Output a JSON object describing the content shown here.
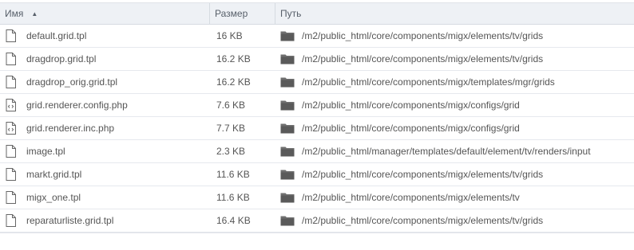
{
  "columns": {
    "name": "Имя",
    "size": "Размер",
    "path": "Путь"
  },
  "sort": {
    "column": "name",
    "direction": "ascending"
  },
  "files": [
    {
      "name": "default.grid.tpl",
      "size": "16 KB",
      "path": "/m2/public_html/core/components/migx/elements/tv/grids",
      "icon": "document-icon"
    },
    {
      "name": "dragdrop.grid.tpl",
      "size": "16.2 KB",
      "path": "/m2/public_html/core/components/migx/elements/tv/grids",
      "icon": "document-icon"
    },
    {
      "name": "dragdrop_orig.grid.tpl",
      "size": "16.2 KB",
      "path": "/m2/public_html/core/components/migx/templates/mgr/grids",
      "icon": "document-icon"
    },
    {
      "name": "grid.renderer.config.php",
      "size": "7.6 KB",
      "path": "/m2/public_html/core/components/migx/configs/grid",
      "icon": "php-file-icon"
    },
    {
      "name": "grid.renderer.inc.php",
      "size": "7.7 KB",
      "path": "/m2/public_html/core/components/migx/configs/grid",
      "icon": "php-file-icon"
    },
    {
      "name": "image.tpl",
      "size": "2.3 KB",
      "path": "/m2/public_html/manager/templates/default/element/tv/renders/input",
      "icon": "document-icon"
    },
    {
      "name": "markt.grid.tpl",
      "size": "11.6 KB",
      "path": "/m2/public_html/core/components/migx/elements/tv/grids",
      "icon": "document-icon"
    },
    {
      "name": "migx_one.tpl",
      "size": "11.6 KB",
      "path": "/m2/public_html/core/components/migx/elements/tv",
      "icon": "document-icon"
    },
    {
      "name": "reparaturliste.grid.tpl",
      "size": "16.4 KB",
      "path": "/m2/public_html/core/components/migx/elements/tv/grids",
      "icon": "document-icon"
    }
  ],
  "colors": {
    "header_bg": "#eef1f5",
    "text": "#555555",
    "folder": "#666666",
    "row_border": "#e6e9ee"
  }
}
